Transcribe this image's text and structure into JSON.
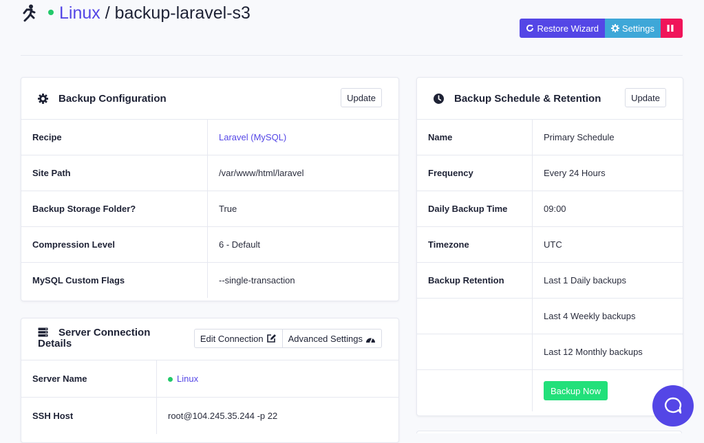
{
  "header": {
    "server_link": "Linux",
    "separator": "/",
    "site_name": "backup-laravel-s3",
    "restore_label": "Restore Wizard",
    "settings_label": "Settings"
  },
  "colors": {
    "accent": "#5446e6",
    "settings": "#3ea7d8",
    "pause": "#f0145a",
    "status_green": "#22c96a",
    "success": "#22e07a"
  },
  "backup_config": {
    "title": "Backup Configuration",
    "update_label": "Update",
    "rows": [
      {
        "label": "Recipe",
        "value": "Laravel (MySQL)"
      },
      {
        "label": "Site Path",
        "value": "/var/www/html/laravel"
      },
      {
        "label": "Backup Storage Folder?",
        "value": "True"
      },
      {
        "label": "Compression Level",
        "value": "6 - Default"
      },
      {
        "label": "MySQL Custom Flags",
        "value": "--single-transaction"
      }
    ]
  },
  "server_connection": {
    "title_line1": "Server Connection",
    "title_line2": "Details",
    "edit_label": "Edit Connection",
    "advanced_label": "Advanced Settings",
    "rows": [
      {
        "label": "Server Name",
        "value": "Linux"
      },
      {
        "label": "SSH Host",
        "value": "root@104.245.35.244 -p 22"
      }
    ]
  },
  "schedule": {
    "title": "Backup Schedule & Retention",
    "update_label": "Update",
    "rows": [
      {
        "label": "Name",
        "value": "Primary Schedule"
      },
      {
        "label": "Frequency",
        "value": "Every 24 Hours"
      },
      {
        "label": "Daily Backup Time",
        "value": "09:00"
      },
      {
        "label": "Timezone",
        "value": "UTC"
      },
      {
        "label": "Backup Retention",
        "value": "Last 1 Daily backups"
      },
      {
        "label": "",
        "value": "Last 4 Weekly backups"
      },
      {
        "label": "",
        "value": "Last 12 Monthly backups"
      }
    ],
    "backup_now_label": "Backup Now"
  },
  "icons": [
    "runner-icon",
    "status-dot-icon",
    "restore-icon",
    "gear-icon",
    "pause-icon",
    "cog-icon",
    "clock-icon",
    "server-icon",
    "edit-icon",
    "gauge-icon",
    "chat-icon"
  ]
}
